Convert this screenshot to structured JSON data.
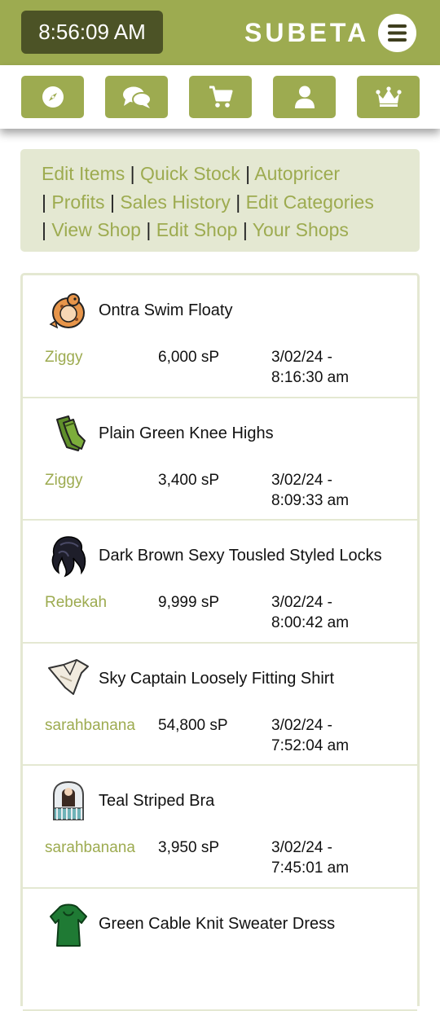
{
  "header": {
    "clock": "8:56:09 AM",
    "brand": "SUBETA",
    "menu_icon": "hamburger-icon"
  },
  "nav": [
    {
      "icon": "compass-icon"
    },
    {
      "icon": "chat-icon"
    },
    {
      "icon": "cart-icon"
    },
    {
      "icon": "user-icon"
    },
    {
      "icon": "crown-icon"
    }
  ],
  "links": {
    "edit_items": "Edit Items",
    "quick_stock": "Quick Stock",
    "autopricer": "Autopricer",
    "profits": "Profits",
    "sales_history": "Sales History",
    "edit_categories": "Edit Categories",
    "view_shop": "View Shop",
    "edit_shop": "Edit Shop",
    "your_shops": "Your Shops",
    "separator": "|"
  },
  "sales": [
    {
      "item": "Ontra Swim Floaty",
      "buyer": "Ziggy",
      "price": "6,000 sP",
      "date": "3/02/24 - 8:16:30 am",
      "icon": "ontra-floaty-icon"
    },
    {
      "item": "Plain Green Knee Highs",
      "buyer": "Ziggy",
      "price": "3,400 sP",
      "date": "3/02/24 - 8:09:33 am",
      "icon": "green-knee-highs-icon"
    },
    {
      "item": "Dark Brown Sexy Tousled Styled Locks",
      "buyer": "Rebekah",
      "price": "9,999 sP",
      "date": "3/02/24 - 8:00:42 am",
      "icon": "hair-locks-icon"
    },
    {
      "item": "Sky Captain Loosely Fitting Shirt",
      "buyer": "sarahbanana",
      "price": "54,800 sP",
      "date": "3/02/24 - 7:52:04 am",
      "icon": "shirt-icon"
    },
    {
      "item": "Teal Striped Bra",
      "buyer": "sarahbanana",
      "price": "3,950 sP",
      "date": "3/02/24 - 7:45:01 am",
      "icon": "bra-icon"
    },
    {
      "item": "Green Cable Knit Sweater Dress",
      "buyer": "",
      "price": "",
      "date": "",
      "icon": "sweater-dress-icon"
    }
  ],
  "colors": {
    "accent": "#9dab50",
    "clock_bg": "#4c5326",
    "panel_bg": "#e4e8d2"
  }
}
